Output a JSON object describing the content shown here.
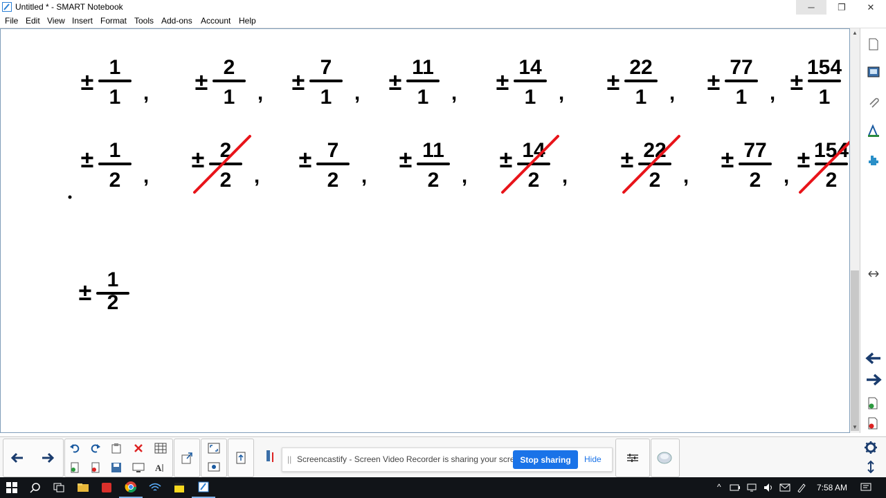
{
  "window": {
    "title": "Untitled * - SMART Notebook",
    "minimize": "─",
    "maximize": "❐",
    "close": "✕"
  },
  "menu": {
    "items": [
      {
        "label": "File"
      },
      {
        "label": "Edit"
      },
      {
        "label": "View"
      },
      {
        "label": "Insert"
      },
      {
        "label": "Format"
      },
      {
        "label": "Tools"
      },
      {
        "label": "Add-ons"
      },
      {
        "label": "Account"
      },
      {
        "label": "Help"
      }
    ]
  },
  "board": {
    "row1": [
      {
        "sign": "±",
        "num": "1",
        "den": "1"
      },
      {
        "sign": "±",
        "num": "2",
        "den": "1"
      },
      {
        "sign": "±",
        "num": "7",
        "den": "1"
      },
      {
        "sign": "±",
        "num": "11",
        "den": "1"
      },
      {
        "sign": "±",
        "num": "14",
        "den": "1"
      },
      {
        "sign": "±",
        "num": "22",
        "den": "1"
      },
      {
        "sign": "±",
        "num": "77",
        "den": "1"
      },
      {
        "sign": "±",
        "num": "154",
        "den": "1"
      }
    ],
    "row2": [
      {
        "sign": "±",
        "num": "1",
        "den": "2",
        "crossed": false
      },
      {
        "sign": "±",
        "num": "2",
        "den": "2",
        "crossed": true
      },
      {
        "sign": "±",
        "num": "7",
        "den": "2",
        "crossed": false
      },
      {
        "sign": "±",
        "num": "11",
        "den": "2",
        "crossed": false
      },
      {
        "sign": "±",
        "num": "14",
        "den": "2",
        "crossed": true
      },
      {
        "sign": "±",
        "num": "22",
        "den": "2",
        "crossed": true
      },
      {
        "sign": "±",
        "num": "77",
        "den": "2",
        "crossed": false
      },
      {
        "sign": "±",
        "num": "154",
        "den": "2",
        "crossed": true
      }
    ],
    "row3": [
      {
        "sign": "±",
        "num": "1",
        "den": "2"
      }
    ],
    "comma": ",",
    "ink_color": "#000000",
    "strike_color": "#e8141a"
  },
  "share": {
    "grip": "||",
    "message": "Screencastify - Screen Video Recorder is sharing your screen.",
    "stop_label": "Stop sharing",
    "hide_label": "Hide"
  },
  "taskbar": {
    "time": "7:58 AM"
  },
  "colors": {
    "accent": "#1a73e8",
    "taskbar": "#111418",
    "nav_arrow": "#1a3c6e"
  }
}
